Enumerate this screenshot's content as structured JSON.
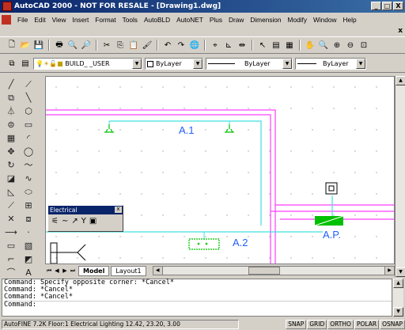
{
  "window": {
    "title": "AutoCAD 2000 - NOT FOR RESALE - [Drawing1.dwg]",
    "close_label": "X",
    "min_label": "_",
    "max_label": "□"
  },
  "menu": {
    "items": [
      "File",
      "Edit",
      "View",
      "Insert",
      "Format",
      "Tools",
      "AutoBLD",
      "AutoNET",
      "Plus",
      "Draw",
      "Dimension",
      "Modify",
      "Window",
      "Help"
    ],
    "doc_close": "x"
  },
  "properties_bar": {
    "layer_value": "BUILD_ _USER",
    "color_value": "ByLayer",
    "linetype_value": "ByLayer",
    "lineweight_value": "ByLayer"
  },
  "drawing": {
    "labels": {
      "a1": "A.1",
      "a2": "A.2",
      "ap": "A.P."
    },
    "colors": {
      "magenta": "#ff40ff",
      "cyan": "#40e0e0",
      "green": "#00c000",
      "blue_text": "#2060ff"
    }
  },
  "palette": {
    "title": "Electrical",
    "close": "x"
  },
  "tabs": {
    "model": "Model",
    "layout1": "Layout1"
  },
  "command": {
    "lines": [
      "Command:  Specify opposite corner: *Cancel*",
      "Command:  *Cancel*",
      "Command:  *Cancel*",
      "Command:"
    ]
  },
  "status": {
    "info": "AutoFINE 7.2K Floor:1 Electrical Lighting 12.42, 23.20, 3.00",
    "toggles": [
      "SNAP",
      "GRID",
      "ORTHO",
      "POLAR",
      "OSNAP"
    ]
  }
}
